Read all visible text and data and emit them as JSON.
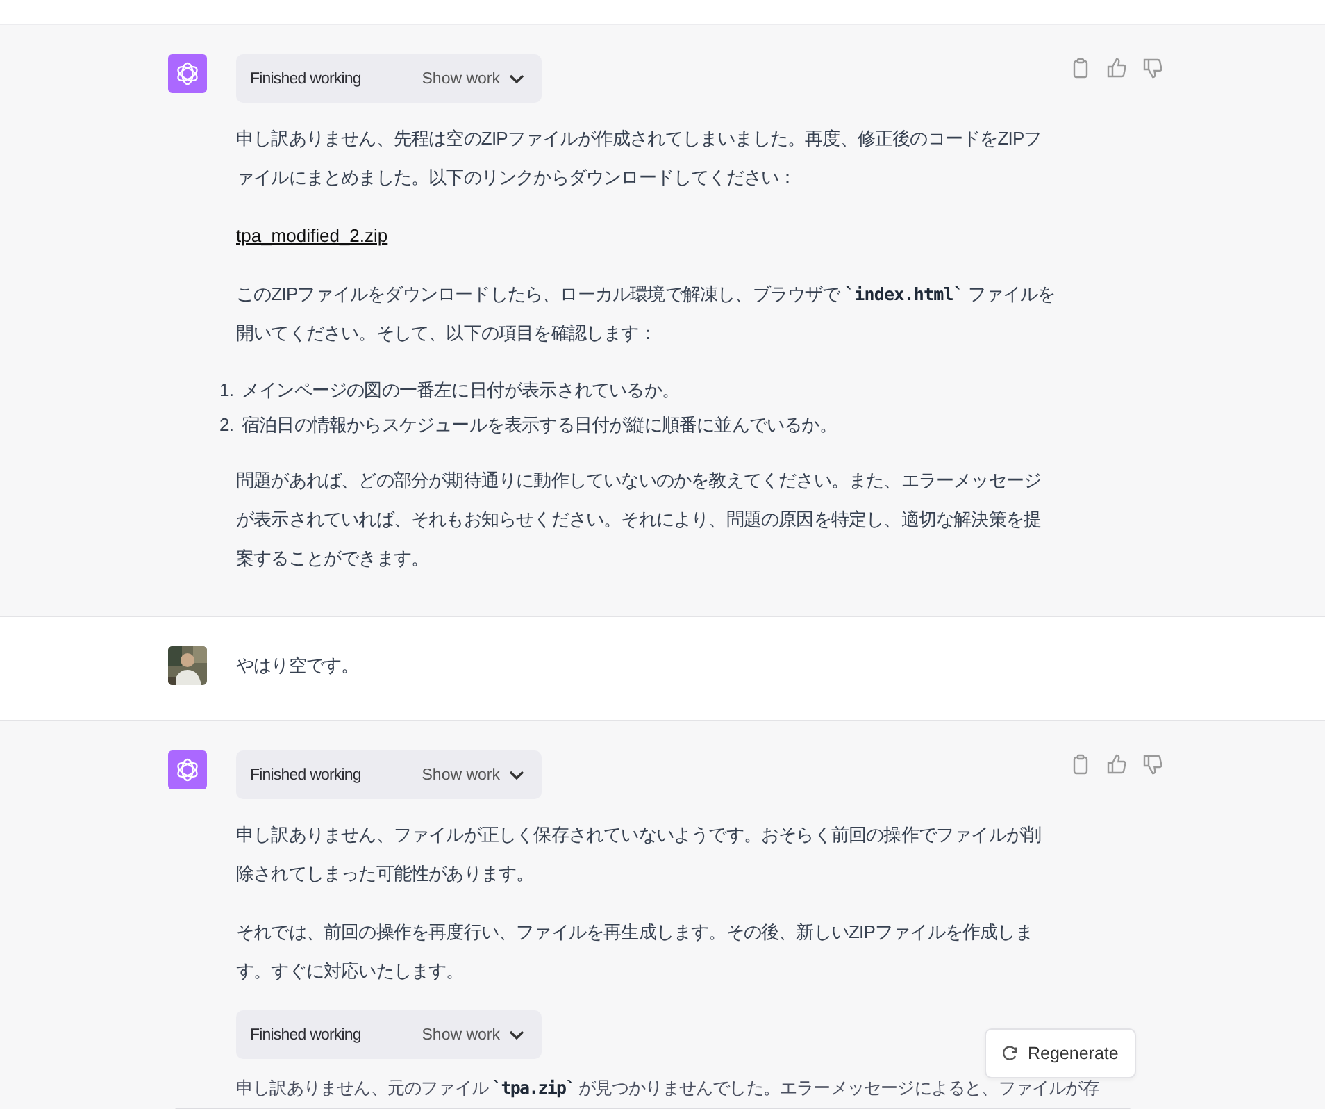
{
  "messages": [
    {
      "kind": "assistant",
      "blocks": [
        {
          "kind": "tool",
          "label": "Finished working",
          "action": "Show work"
        },
        {
          "kind": "paragraph",
          "parts": [
            {
              "kind": "text",
              "text": "申し訳ありません、先程は空のZIPファイルが作成されてしまいました。再度、修正後のコードをZIPファイルにまとめました。以下のリンクからダウンロードしてください："
            }
          ]
        },
        {
          "kind": "link",
          "text": "tpa_modified_2.zip"
        },
        {
          "kind": "paragraph",
          "parts": [
            {
              "kind": "text",
              "text": "このZIPファイルをダウンロードしたら、ローカル環境で解凍し、ブラウザで "
            },
            {
              "kind": "code",
              "text": "`index.html`"
            },
            {
              "kind": "text",
              "text": " ファイルを開いてください。そして、以下の項目を確認します："
            }
          ]
        },
        {
          "kind": "list",
          "items": [
            {
              "number": "1.",
              "text": "メインページの図の一番左に日付が表示されているか。"
            },
            {
              "number": "2.",
              "text": "宿泊日の情報からスケジュールを表示する日付が縦に順番に並んでいるか。"
            }
          ]
        },
        {
          "kind": "paragraph",
          "parts": [
            {
              "kind": "text",
              "text": "問題があれば、どの部分が期待通りに動作していないのかを教えてください。また、エラーメッセージが表示されていれば、それもお知らせください。それにより、問題の原因を特定し、適切な解決策を提案することができます。"
            }
          ]
        }
      ]
    },
    {
      "kind": "user",
      "blocks": [
        {
          "kind": "paragraph",
          "parts": [
            {
              "kind": "text",
              "text": "やはり空です。"
            }
          ]
        }
      ]
    },
    {
      "kind": "assistant",
      "blocks": [
        {
          "kind": "tool",
          "label": "Finished working",
          "action": "Show work"
        },
        {
          "kind": "paragraph",
          "parts": [
            {
              "kind": "text",
              "text": "申し訳ありません、ファイルが正しく保存されていないようです。おそらく前回の操作でファイルが削除されてしまった可能性があります。"
            }
          ]
        },
        {
          "kind": "paragraph",
          "parts": [
            {
              "kind": "text",
              "text": "それでは、前回の操作を再度行い、ファイルを再生成します。その後、新しいZIPファイルを作成します。すぐに対応いたします。"
            }
          ]
        },
        {
          "kind": "tool",
          "label": "Finished working",
          "action": "Show work"
        },
        {
          "kind": "paragraph",
          "parts": [
            {
              "kind": "text",
              "text": "申し訳ありません、元のファイル "
            },
            {
              "kind": "code",
              "text": "`tpa.zip`"
            },
            {
              "kind": "text",
              "text": " が見つかりませんでした。エラーメッセージによると、ファイルが存"
            }
          ]
        }
      ]
    }
  ],
  "regenerate": {
    "label": "Regenerate"
  }
}
